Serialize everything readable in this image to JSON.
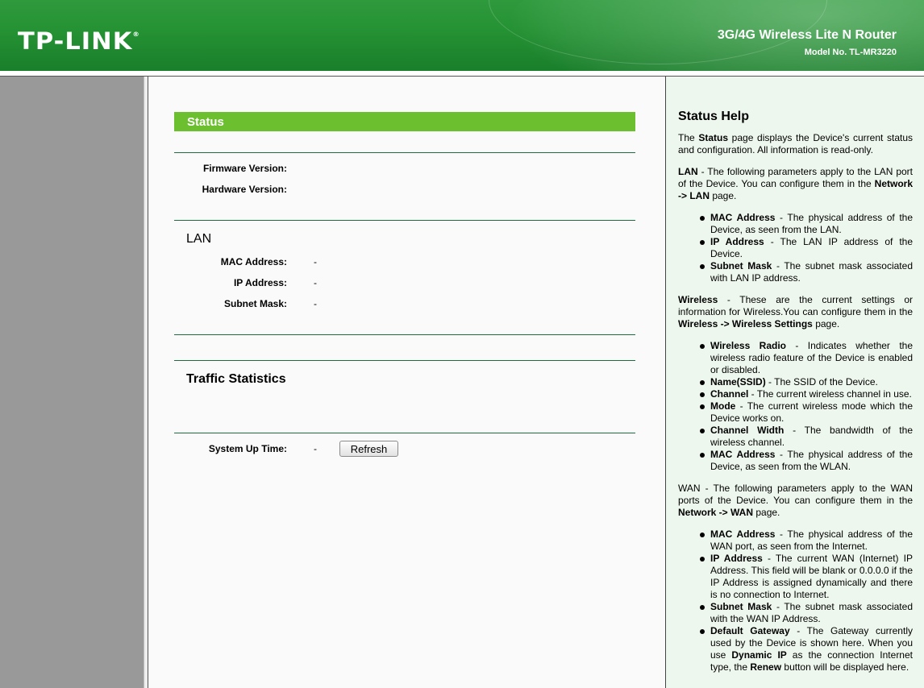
{
  "header": {
    "logo": "TP-LINK",
    "logo_mark": "®",
    "product": "3G/4G Wireless Lite N Router",
    "model": "Model No. TL-MR3220"
  },
  "status": {
    "title": "Status",
    "firmware_label": "Firmware Version:",
    "hardware_label": "Hardware Version:",
    "lan": {
      "title": "LAN",
      "mac_label": "MAC Address:",
      "mac_value": "-",
      "ip_label": "IP Address:",
      "ip_value": "-",
      "mask_label": "Subnet Mask:",
      "mask_value": "-"
    },
    "traffic_title": "Traffic Statistics",
    "uptime_label": "System Up Time:",
    "uptime_value": "-",
    "refresh_label": "Refresh"
  },
  "help": {
    "title": "Status Help",
    "intro": {
      "a": "The ",
      "b": "Status",
      "c": " page displays the Device's current status and configuration. All information is read-only."
    },
    "lan": {
      "b": "LAN",
      "a": " - The following parameters apply to the LAN port of the Device. You can configure them in the ",
      "link": "Network -> LAN",
      "c": " page."
    },
    "lan_items": [
      {
        "term": "MAC Address",
        "desc": " - The physical address of the Device, as seen from the LAN."
      },
      {
        "term": "IP Address",
        "desc": " - The LAN IP address of the Device."
      },
      {
        "term": "Subnet Mask",
        "desc": " - The subnet mask associated with LAN IP address."
      }
    ],
    "wireless": {
      "b": "Wireless",
      "a": " - These are the current settings or information for Wireless.You can configure them in the ",
      "link": "Wireless -> Wireless Settings",
      "c": " page."
    },
    "wireless_items": [
      {
        "term": "Wireless Radio",
        "desc": " - Indicates whether the wireless radio feature of the Device is enabled or disabled."
      },
      {
        "term": "Name(SSID)",
        "desc": " - The SSID of the Device."
      },
      {
        "term": "Channel",
        "desc": " - The current wireless channel in use."
      },
      {
        "term": "Mode",
        "desc": " - The current wireless mode which the Device works on."
      },
      {
        "term": "Channel Width",
        "desc": " - The bandwidth of the wireless channel."
      },
      {
        "term": "MAC Address",
        "desc": " - The physical address of the Device, as seen from the WLAN."
      }
    ],
    "wan": {
      "a": "WAN - The following parameters apply to the WAN ports of the Device. You can configure them in the ",
      "link": "Network -> WAN",
      "c": " page."
    },
    "wan_items": [
      {
        "term": "MAC Address",
        "desc": " - The physical address of the WAN port, as seen from the Internet."
      },
      {
        "term": "IP Address",
        "desc": " - The current WAN (Internet) IP Address. This field will be blank or 0.0.0.0 if the IP Address is assigned dynamically and there is no connection to Internet."
      },
      {
        "term": "Subnet Mask",
        "desc": " - The subnet mask associated with the WAN IP Address."
      }
    ],
    "gateway": {
      "term": "Default Gateway",
      "a": " - The Gateway currently used by the Device is shown here. When you use ",
      "b": "Dynamic IP",
      "c": " as the connection Internet type, the ",
      "d": "Renew",
      "e": " button will be displayed here."
    }
  }
}
